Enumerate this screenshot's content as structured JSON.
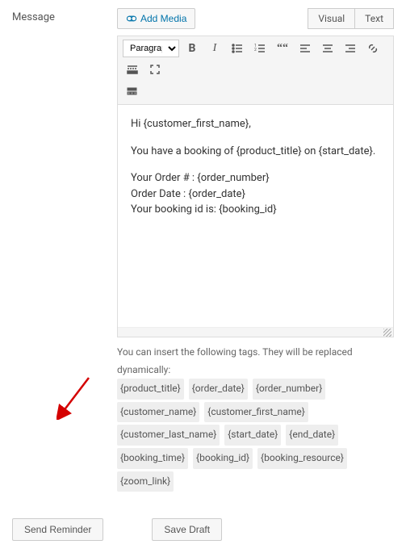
{
  "label": "Message",
  "addMedia": "Add Media",
  "tabs": {
    "visual": "Visual",
    "text": "Text"
  },
  "toolbar": {
    "format": "Paragraph"
  },
  "content": {
    "p1": "Hi {customer_first_name},",
    "p2": "You have a booking of {product_title} on {start_date}.",
    "p3l1": "Your Order # : {order_number}",
    "p3l2": "Order Date : {order_date}",
    "p3l3": "Your booking id is: {booking_id}"
  },
  "hint": {
    "intro": "You can insert the following tags. They will be replaced dynamically:",
    "tags": [
      "{product_title}",
      "{order_date}",
      "{order_number}",
      "{customer_name}",
      "{customer_first_name}",
      "{customer_last_name}",
      "{start_date}",
      "{end_date}",
      "{booking_time}",
      "{booking_id}",
      "{booking_resource}",
      "{zoom_link}"
    ]
  },
  "buttons": {
    "send": "Send Reminder",
    "draft": "Save Draft"
  }
}
